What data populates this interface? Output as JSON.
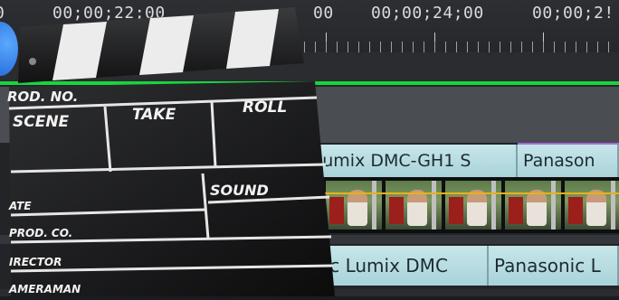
{
  "ruler": {
    "timecodes": [
      "0",
      "00;00;22;00",
      "00",
      "00;00;24;00",
      "00;00;2!"
    ]
  },
  "clips": {
    "top_track": [
      "Lumix DMC-GH1 S",
      "Panason"
    ],
    "bottom_track": [
      "nic Lumix DMC",
      "Panasonic L"
    ]
  },
  "clapperboard": {
    "labels": {
      "prod_no": "ROD. NO.",
      "scene": "SCENE",
      "take": "TAKE",
      "roll": "ROLL",
      "sound": "SOUND",
      "date": "ATE",
      "prod_co": "PROD. CO.",
      "director": "IRECTOR",
      "cameraman": "AMERAMAN"
    }
  },
  "colors": {
    "work_area_bar": "#19d43e",
    "clip_fill": "#b8dde2",
    "marker_purple": "#a26bd8",
    "playhead_yellow": "#e8b11a"
  }
}
